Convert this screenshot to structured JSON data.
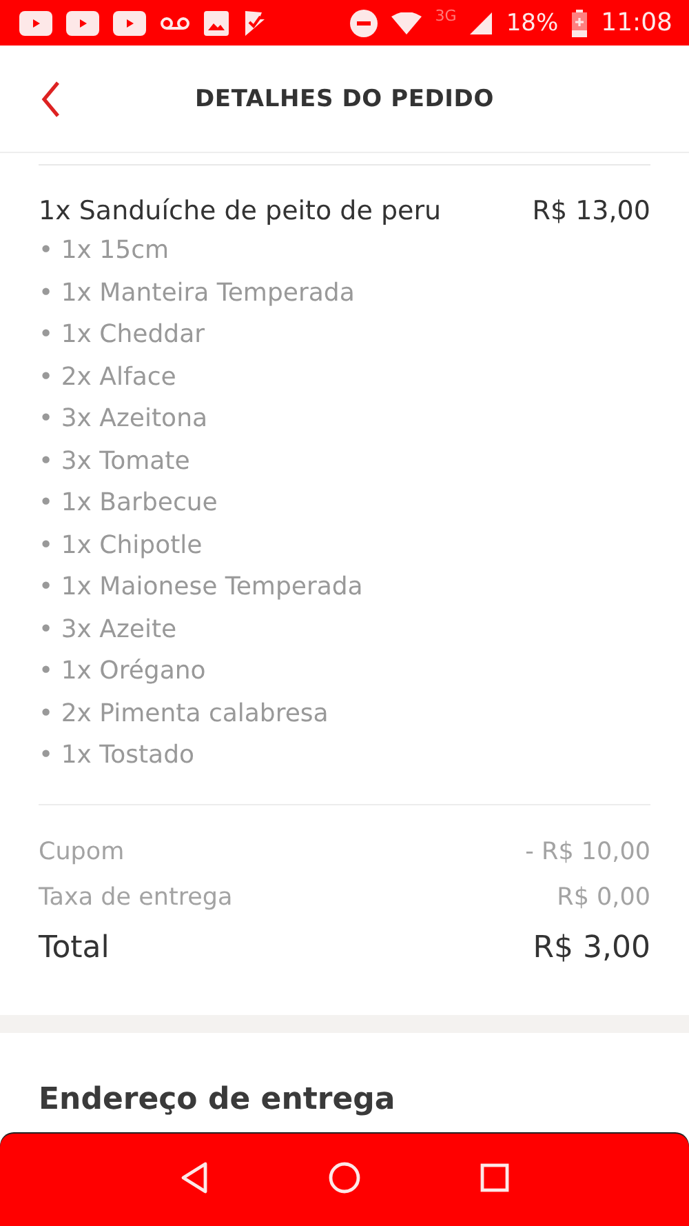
{
  "status_bar": {
    "network": "3G",
    "battery": "18%",
    "time": "11:08"
  },
  "header": {
    "title": "DETALHES DO PEDIDO"
  },
  "item": {
    "name": "1x Sanduíche de peito de peru",
    "price": "R$ 13,00",
    "options": [
      "• 1x 15cm",
      "• 1x Manteira Temperada",
      "• 1x Cheddar",
      "• 2x Alface",
      "• 3x Azeitona",
      "• 3x Tomate",
      "• 1x Barbecue",
      "• 1x Chipotle",
      "• 1x Maionese Temperada",
      "• 3x Azeite",
      "• 1x Orégano",
      "• 2x Pimenta calabresa",
      "• 1x Tostado"
    ]
  },
  "summary": [
    {
      "label": "Cupom",
      "value": "- R$ 10,00",
      "kind": "minor"
    },
    {
      "label": "Taxa de entrega",
      "value": "R$ 0,00",
      "kind": "minor"
    },
    {
      "label": "Total",
      "value": "R$ 3,00",
      "kind": "total"
    }
  ],
  "address": {
    "title": "Endereço de entrega"
  }
}
